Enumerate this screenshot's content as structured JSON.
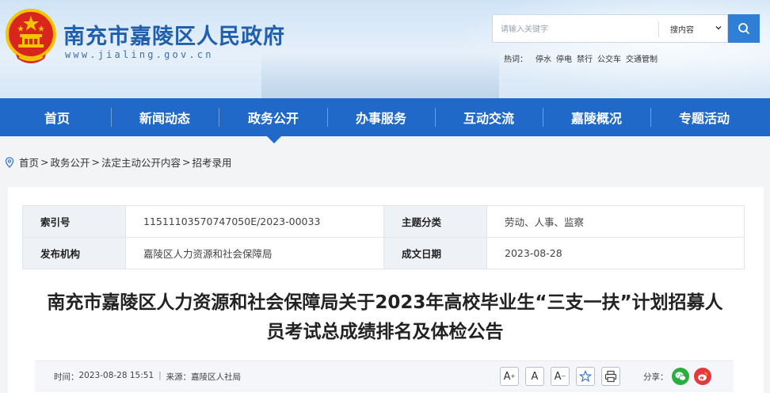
{
  "header": {
    "site_title": "南充市嘉陵区人民政府",
    "site_url": "www.jialing.gov.cn",
    "search": {
      "placeholder": "请输入关键字",
      "scope_value": "搜内容",
      "scope_icon": "chevron-down-icon",
      "button_icon": "search-icon"
    },
    "hot": {
      "label": "热词：",
      "items": [
        "停水",
        "停电",
        "禁行",
        "公交车",
        "交通管制"
      ]
    }
  },
  "nav": {
    "items": [
      "首页",
      "新闻动态",
      "政务公开",
      "办事服务",
      "互动交流",
      "嘉陵概况",
      "专题活动"
    ],
    "active": "政务公开"
  },
  "breadcrumb": {
    "icon": "location-pin-icon",
    "items": [
      "首页",
      "政务公开",
      "法定主动公开内容",
      "招考录用"
    ],
    "separator": ">"
  },
  "meta": {
    "index_label": "索引号",
    "index_value": "11511103570747050E/2023-00033",
    "topic_label": "主题分类",
    "topic_value": "劳动、人事、监察",
    "publisher_label": "发布机构",
    "publisher_value": "嘉陵区人力资源和社会保障局",
    "date_label": "成文日期",
    "date_value": "2023-08-28"
  },
  "article": {
    "title": "南充市嘉陵区人力资源和社会保障局关于2023年高校毕业生“三支一扶”计划招募人员考试总成绩排名及体检公告",
    "time_label": "时间：",
    "time_value": "2023-08-28 15:51",
    "source_label": "来源：",
    "source_value": "嘉陵区人社局"
  },
  "tools": {
    "font_larger": "A",
    "font_normal": "A",
    "font_smaller": "A",
    "favorite_icon": "star-icon",
    "print_icon": "printer-icon",
    "share_label": "分享：",
    "share_icons": [
      "wechat-icon",
      "weibo-icon"
    ]
  },
  "colors": {
    "brand_blue": "#2169c8",
    "title_blue": "#1f5fae",
    "search_button": "#2f7fd6",
    "wechat_green": "#2aae3f",
    "weibo_red": "#e4393c"
  }
}
